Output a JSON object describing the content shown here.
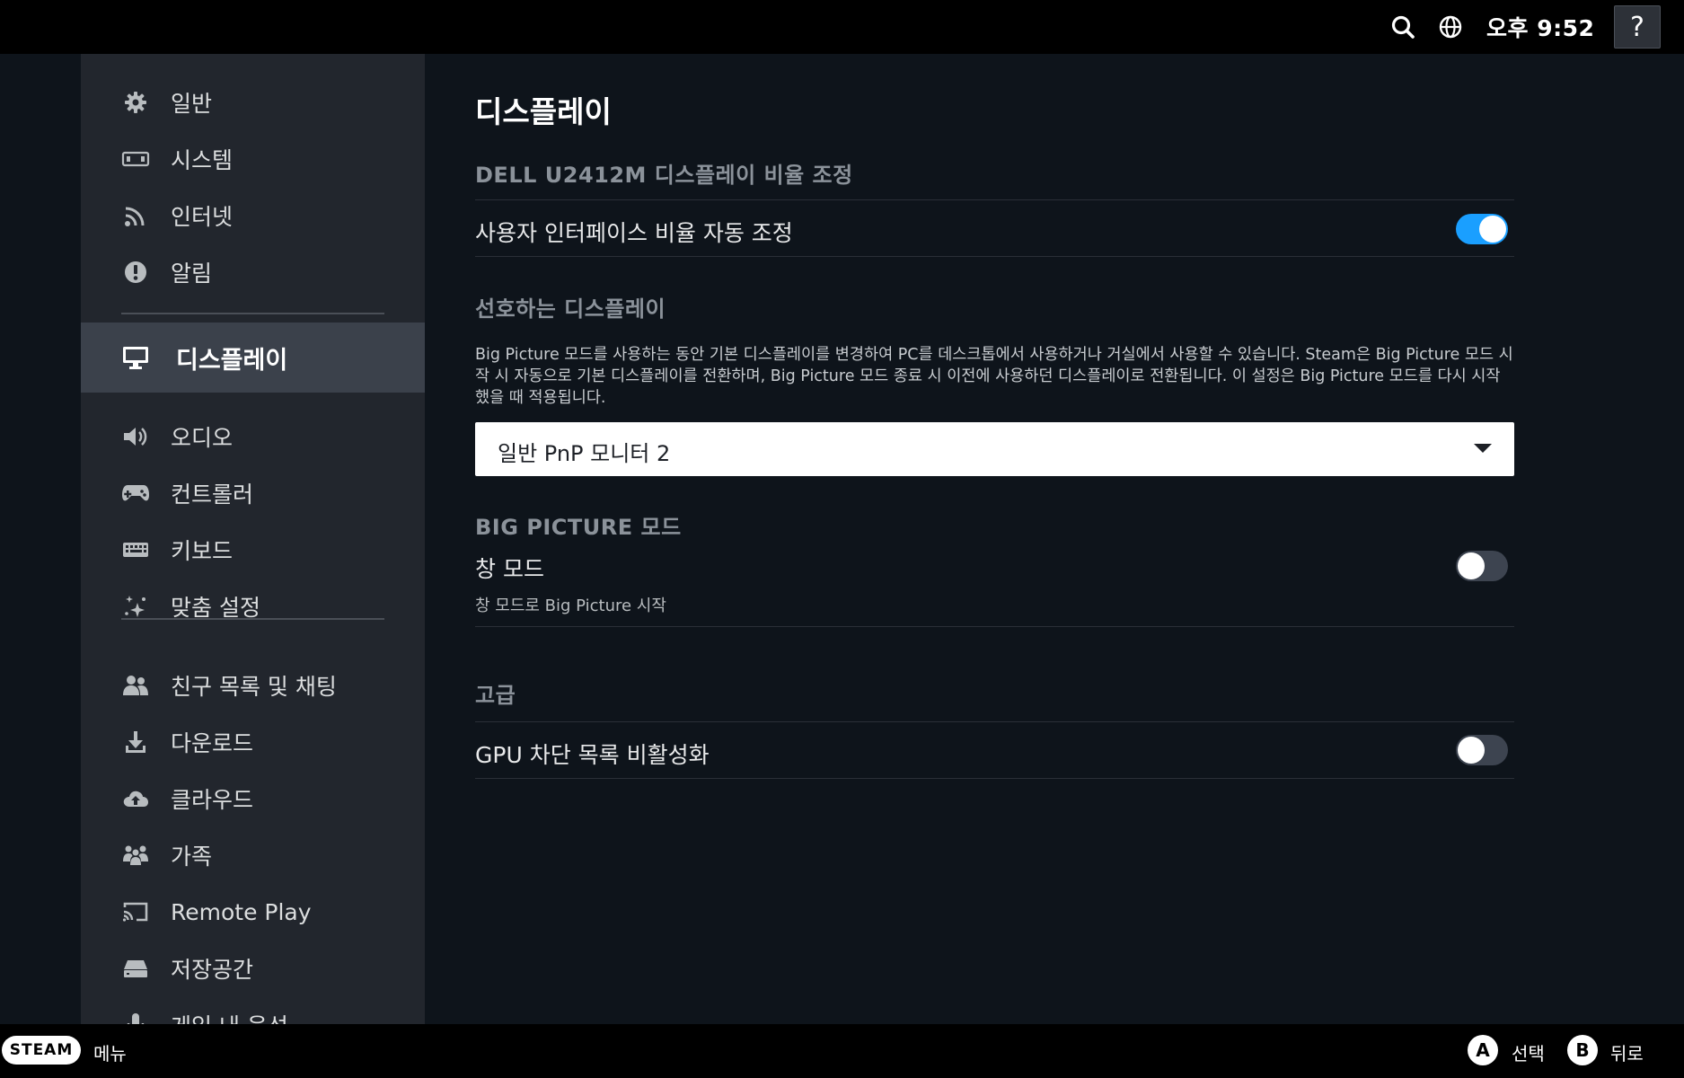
{
  "topbar": {
    "icons": [
      "search-icon",
      "globe-icon"
    ],
    "clock": "오후 9:52",
    "help_label": "?"
  },
  "sidebar": {
    "items": [
      {
        "label": "일반",
        "icon": "gear-icon"
      },
      {
        "label": "시스템",
        "icon": "system-icon"
      },
      {
        "label": "인터넷",
        "icon": "wifi-icon"
      },
      {
        "label": "알림",
        "icon": "alert-icon"
      },
      {
        "label": "디스플레이",
        "icon": "monitor-icon",
        "active": true
      },
      {
        "label": "오디오",
        "icon": "speaker-icon"
      },
      {
        "label": "컨트롤러",
        "icon": "gamepad-icon"
      },
      {
        "label": "키보드",
        "icon": "keyboard-icon"
      },
      {
        "label": "맞춤 설정",
        "icon": "sparkle-icon"
      },
      {
        "label": "친구 목록 및 채팅",
        "icon": "friends-icon"
      },
      {
        "label": "다운로드",
        "icon": "download-icon"
      },
      {
        "label": "클라우드",
        "icon": "cloud-icon"
      },
      {
        "label": "가족",
        "icon": "family-icon"
      },
      {
        "label": "Remote Play",
        "icon": "cast-icon"
      },
      {
        "label": "저장공간",
        "icon": "storage-icon"
      },
      {
        "label": "게임 내 음성",
        "icon": "microphone-icon"
      }
    ]
  },
  "main": {
    "title": "디스플레이",
    "scale_section": "DELL U2412M 디스플레이 비율 조정",
    "auto_scale_label": "사용자 인터페이스 비율 자동 조정",
    "auto_scale_on": true,
    "preferred_section": "선호하는 디스플레이",
    "preferred_desc": "Big Picture 모드를 사용하는 동안 기본 디스플레이를 변경하여 PC를 데스크톱에서 사용하거나 거실에서 사용할 수 있습니다. Steam은 Big Picture 모드 시작 시 자동으로 기본 디스플레이를 전환하며, Big Picture 모드 종료 시 이전에 사용하던 디스플레이로 전환됩니다. 이 설정은 Big Picture 모드를 다시 시작했을 때 적용됩니다.",
    "preferred_value": "일반 PnP 모니터 2",
    "bigpicture_section": "BIG PICTURE 모드",
    "window_mode_label": "창 모드",
    "window_mode_sub": "창 모드로 Big Picture 시작",
    "window_mode_on": false,
    "advanced_section": "고급",
    "gpu_label": "GPU 차단 목록 비활성화",
    "gpu_on": false
  },
  "bottombar": {
    "steam_label": "STEAM",
    "menu_label": "메뉴",
    "a_key": "A",
    "a_label": "선택",
    "b_key": "B",
    "b_label": "뒤로"
  },
  "colors": {
    "accent": "#1a9fff",
    "sidebar_bg": "#22262d",
    "active_bg": "#3b414b",
    "page_bg": "#0e141b"
  }
}
